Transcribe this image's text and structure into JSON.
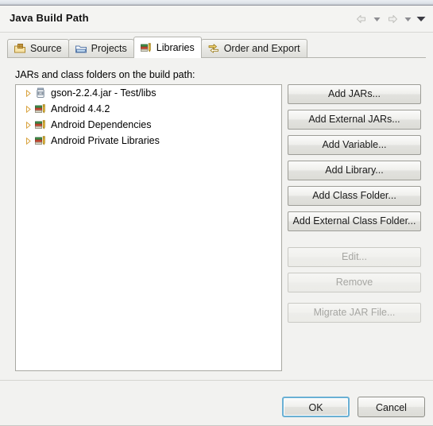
{
  "window": {
    "title": "Java Build Path"
  },
  "nav": {
    "back_icon": "back-arrow-icon",
    "back_dropdown_icon": "chevron-down-icon",
    "forward_icon": "forward-arrow-icon",
    "forward_dropdown_icon": "chevron-down-icon",
    "menu_icon": "chevron-down-icon"
  },
  "tabs": [
    {
      "label": "Source",
      "icon": "source-folder-icon",
      "selected": false
    },
    {
      "label": "Projects",
      "icon": "projects-folder-icon",
      "selected": false
    },
    {
      "label": "Libraries",
      "icon": "libraries-books-icon",
      "selected": true
    },
    {
      "label": "Order and Export",
      "icon": "order-export-arrows-icon",
      "selected": false
    }
  ],
  "main": {
    "tree_label": "JARs and class folders on the build path:",
    "tree_items": [
      {
        "label": "gson-2.2.4.jar - Test/libs",
        "icon": "jar-icon",
        "expandable": true,
        "expanded": false
      },
      {
        "label": "Android 4.4.2",
        "icon": "library-icon",
        "expandable": true,
        "expanded": false
      },
      {
        "label": "Android Dependencies",
        "icon": "library-icon",
        "expandable": true,
        "expanded": false
      },
      {
        "label": "Android Private Libraries",
        "icon": "library-icon",
        "expandable": true,
        "expanded": false
      }
    ],
    "buttons": [
      {
        "label": "Add JARs...",
        "enabled": true,
        "gap": ""
      },
      {
        "label": "Add External JARs...",
        "enabled": true,
        "gap": ""
      },
      {
        "label": "Add Variable...",
        "enabled": true,
        "gap": ""
      },
      {
        "label": "Add Library...",
        "enabled": true,
        "gap": ""
      },
      {
        "label": "Add Class Folder...",
        "enabled": true,
        "gap": ""
      },
      {
        "label": "Add External Class Folder...",
        "enabled": true,
        "gap": ""
      },
      {
        "label": "Edit...",
        "enabled": false,
        "gap": "btn-gap-lg"
      },
      {
        "label": "Remove",
        "enabled": false,
        "gap": ""
      },
      {
        "label": "Migrate JAR File...",
        "enabled": false,
        "gap": "btn-gap-md"
      }
    ]
  },
  "footer": {
    "ok_label": "OK",
    "cancel_label": "Cancel"
  },
  "colors": {
    "default_button_focus": "#6ab0d4",
    "dialog_background": "#f2f2f0",
    "tree_background": "#ffffff",
    "twisty_arrow": "#d9a441"
  }
}
